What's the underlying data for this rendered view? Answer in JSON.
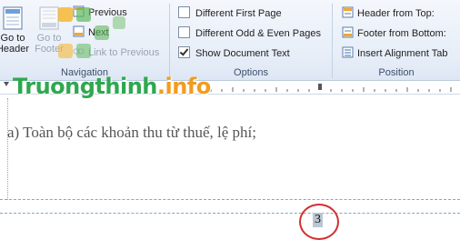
{
  "navigation": {
    "go_to_header": "Go to Header",
    "go_to_footer": "Go to Footer",
    "previous": "Previous",
    "next": "Next",
    "link_to_previous": "Link to Previous",
    "group_label": "Navigation"
  },
  "options": {
    "different_first_page": "Different First Page",
    "different_odd_even": "Different Odd & Even Pages",
    "show_document_text": "Show Document Text",
    "show_document_text_checked": true,
    "group_label": "Options"
  },
  "position": {
    "header_from_top": "Header from Top:",
    "footer_from_bottom": "Footer from Bottom:",
    "insert_alignment_tab": "Insert Alignment Tab",
    "group_label": "Position"
  },
  "watermark": {
    "text_main": "Truongthinh",
    "text_dot": ".info"
  },
  "document": {
    "body_text": "a) Toàn bộ các khoản thu từ thuế, lệ phí;",
    "page_number": "3"
  },
  "colors": {
    "annotation_circle": "#d32f2f",
    "watermark_green": "#2fa84f",
    "watermark_orange": "#f29c1f"
  }
}
